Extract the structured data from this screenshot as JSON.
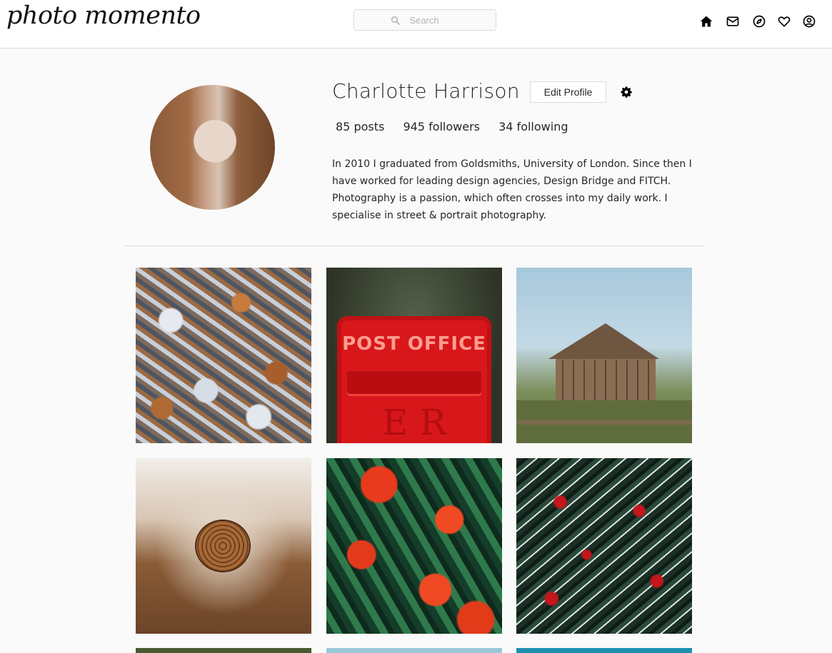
{
  "header": {
    "logo_text": "photo momento",
    "search_placeholder": "Search",
    "nav_icons": [
      "home-icon",
      "inbox-icon",
      "explore-icon",
      "heart-icon",
      "user-circle-icon"
    ]
  },
  "profile": {
    "name": "Charlotte Harrison",
    "edit_label": "Edit Profile",
    "posts": "85 posts",
    "followers": "945 followers",
    "following": "34 following",
    "bio": "In 2010 I graduated from Goldsmiths, University of London. Since then I have worked for leading design agencies, Design Bridge and FITCH. Photography is a passion, which often crosses into my daily work. I specialise in street & portrait photography."
  },
  "posts": [
    {
      "sign_text": "POST OFFICE",
      "cipher_text": "E R"
    }
  ],
  "colors": {
    "background": "#fafafa",
    "border": "#dbdbdb",
    "text": "#262626"
  }
}
